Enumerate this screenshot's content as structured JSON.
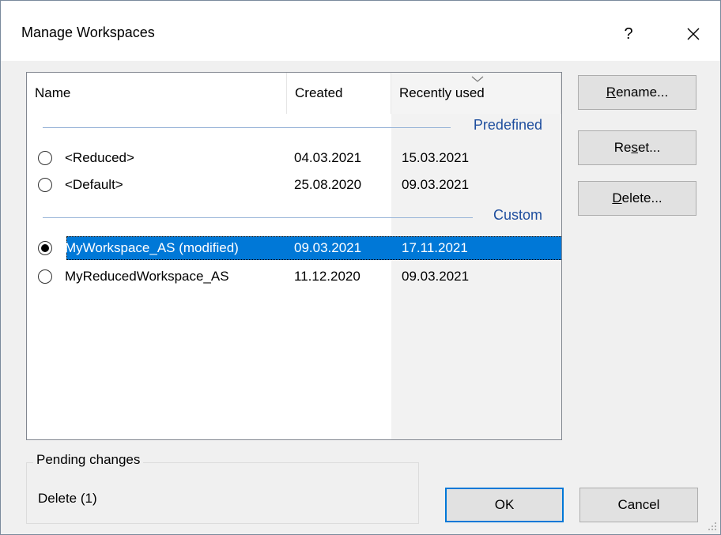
{
  "dialog": {
    "title": "Manage Workspaces",
    "help_label": "?",
    "close_icon": "close-icon"
  },
  "list": {
    "columns": {
      "name": "Name",
      "created": "Created",
      "recently_used": "Recently used"
    },
    "sort_indicator": "sort-descending-icon",
    "groups": [
      {
        "label": "Predefined",
        "items": [
          {
            "name": "<Reduced>",
            "created": "04.03.2021",
            "recently_used": "15.03.2021",
            "checked": false,
            "selected": false
          },
          {
            "name": "<Default>",
            "created": "25.08.2020",
            "recently_used": "09.03.2021",
            "checked": false,
            "selected": false
          }
        ]
      },
      {
        "label": "Custom",
        "items": [
          {
            "name": "MyWorkspace_AS (modified)",
            "created": "09.03.2021",
            "recently_used": "17.11.2021",
            "checked": true,
            "selected": true
          },
          {
            "name": "MyReducedWorkspace_AS",
            "created": "11.12.2020",
            "recently_used": "09.03.2021",
            "checked": false,
            "selected": false
          }
        ]
      }
    ]
  },
  "buttons": {
    "rename": {
      "pre": "",
      "key": "R",
      "post": "ename..."
    },
    "reset": {
      "pre": "Re",
      "key": "s",
      "post": "et..."
    },
    "delete": {
      "pre": "",
      "key": "D",
      "post": "elete..."
    },
    "ok": "OK",
    "cancel": "Cancel"
  },
  "pending": {
    "title": "Pending changes",
    "text": "Delete (1)"
  },
  "colors": {
    "selection": "#0078d7",
    "group_label": "#1e4e9e",
    "dialog_bg": "#f0f0f0"
  }
}
